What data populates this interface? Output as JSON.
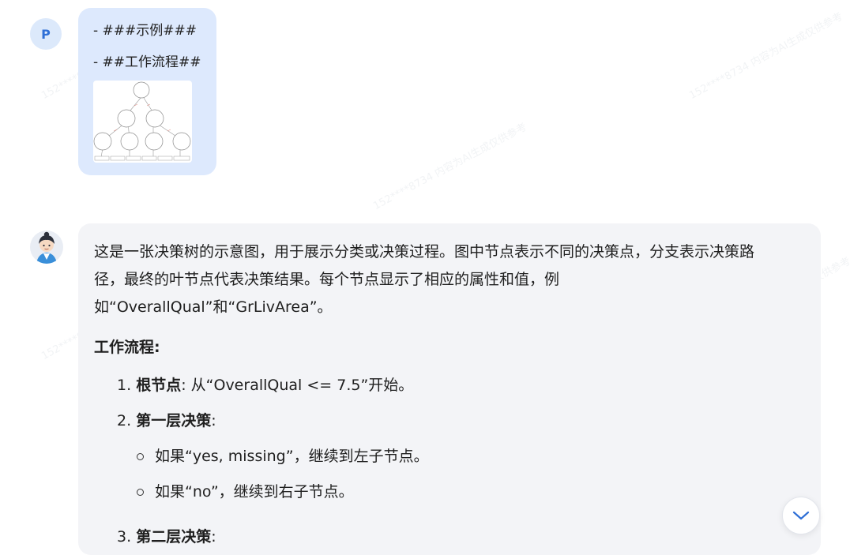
{
  "user": {
    "avatar_letter": "P",
    "lines": [
      "- ###示例###",
      "- ##工作流程##"
    ]
  },
  "assistant": {
    "intro_lines": [
      "这是一张决策树的示意图，用于展示分类或决策过程。图中节点表示不同的决策点，分支表示决策路",
      "径，最终的叶节点代表决策结果。每个节点显示了相应的属性和值，例",
      "如“OverallQual”和“GrLivArea”。"
    ],
    "section_title": "工作流程:",
    "steps": [
      {
        "num": "1.",
        "bold": "根节点",
        "rest": ": 从“OverallQual <= 7.5”开始。"
      },
      {
        "num": "2.",
        "bold": "第一层决策",
        "rest": ":"
      },
      {
        "num": "3.",
        "bold": "第二层决策",
        "rest": ":"
      }
    ],
    "sub_items": [
      "如果“yes, missing”，继续到左子节点。",
      "如果“no”，继续到右子节点。"
    ]
  },
  "icons": {
    "scroll_down": "chevron-down-icon",
    "assistant_avatar": "assistant-avatar-icon"
  },
  "colors": {
    "user_bubble": "#dde9fd",
    "assistant_bubble": "#f3f4f7",
    "accent": "#2f6fd6"
  }
}
